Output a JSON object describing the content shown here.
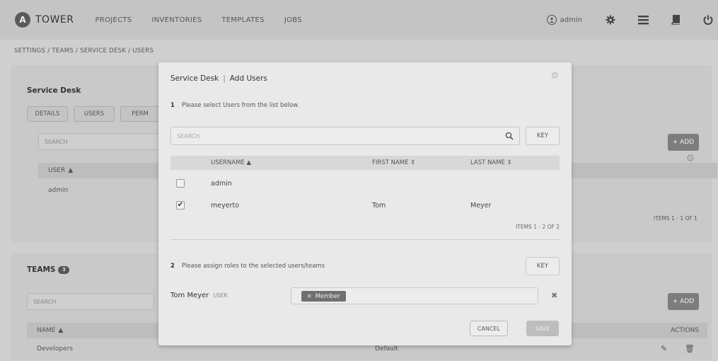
{
  "nav": {
    "brand_letter": "A",
    "brand_name": "TOWER",
    "links": [
      "PROJECTS",
      "INVENTORIES",
      "TEMPLATES",
      "JOBS"
    ],
    "user": "admin",
    "icons": [
      "gear-icon",
      "list-icon",
      "book-icon",
      "power-icon"
    ]
  },
  "breadcrumb": "SETTINGS / TEAMS / Service Desk / USERS",
  "team_panel": {
    "title": "Service Desk",
    "tabs": [
      "DETAILS",
      "USERS",
      "PERM"
    ],
    "search_placeholder": "SEARCH",
    "add_label": "+ ADD",
    "column_user": "USER",
    "user_row": "admin",
    "items_count": "ITEMS 1 - 1 OF 1"
  },
  "teams_panel": {
    "title": "TEAMS",
    "badge": "3",
    "search_placeholder": "SEARCH",
    "add_label": "+ ADD",
    "column_name": "NAME",
    "column_actions": "ACTIONS",
    "row_name": "Developers",
    "row_org": "Default"
  },
  "modal": {
    "title_team": "Service Desk",
    "title_action": "Add Users",
    "step1_num": "1",
    "step1_text": "Please select Users from the list below.",
    "search_placeholder": "SEARCH",
    "key_label": "KEY",
    "columns": {
      "username": "USERNAME",
      "first_name": "FIRST NAME",
      "last_name": "LAST NAME"
    },
    "rows": [
      {
        "username": "admin",
        "first_name": "",
        "last_name": "",
        "checked": false
      },
      {
        "username": "meyerto",
        "first_name": "Tom",
        "last_name": "Meyer",
        "checked": true
      }
    ],
    "items_count": "ITEMS 1 - 2 OF 2",
    "step2_num": "2",
    "step2_text": "Please assign roles to the selected users/teams",
    "key2_label": "KEY",
    "assign": {
      "name": "Tom Meyer",
      "type": "USER",
      "role": "Member"
    },
    "cancel_label": "CANCEL",
    "save_label": "SAVE"
  },
  "colors": {
    "overlay": "#cfcfcf",
    "modal_bg": "#e9e9e9",
    "role_tag": "#6f6f6f",
    "add_button": "#7d7d7d"
  }
}
